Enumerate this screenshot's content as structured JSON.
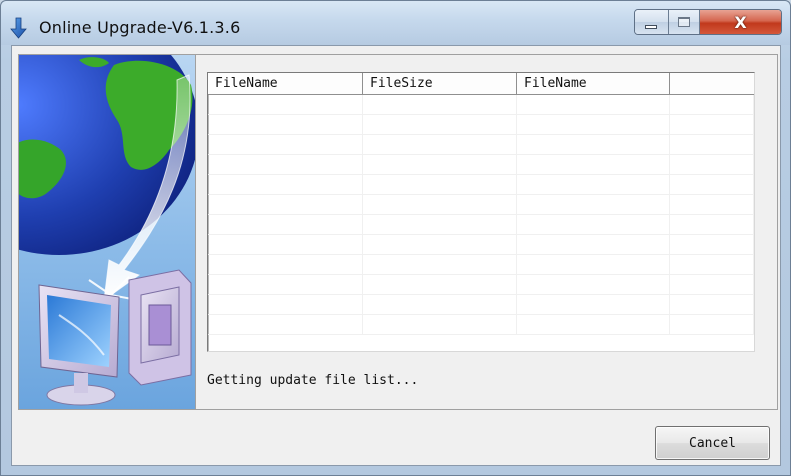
{
  "window": {
    "title": "Online Upgrade-V6.1.3.6",
    "icons": {
      "app": "download-arrow-icon",
      "minimize": "minimize-icon",
      "maximize": "maximize-icon",
      "close": "close-icon"
    },
    "close_glyph": "X"
  },
  "banner": {
    "image": "globe-arrow-computer-illustration"
  },
  "file_list": {
    "columns": [
      "FileName",
      "FileSize",
      "FileName",
      ""
    ],
    "rows": []
  },
  "status": {
    "message": "Getting update file list..."
  },
  "buttons": {
    "cancel_label": "Cancel"
  },
  "colors": {
    "close_button": "#c1391d",
    "globe_blue": "#1f3fb0",
    "globe_green": "#3cab2a"
  }
}
